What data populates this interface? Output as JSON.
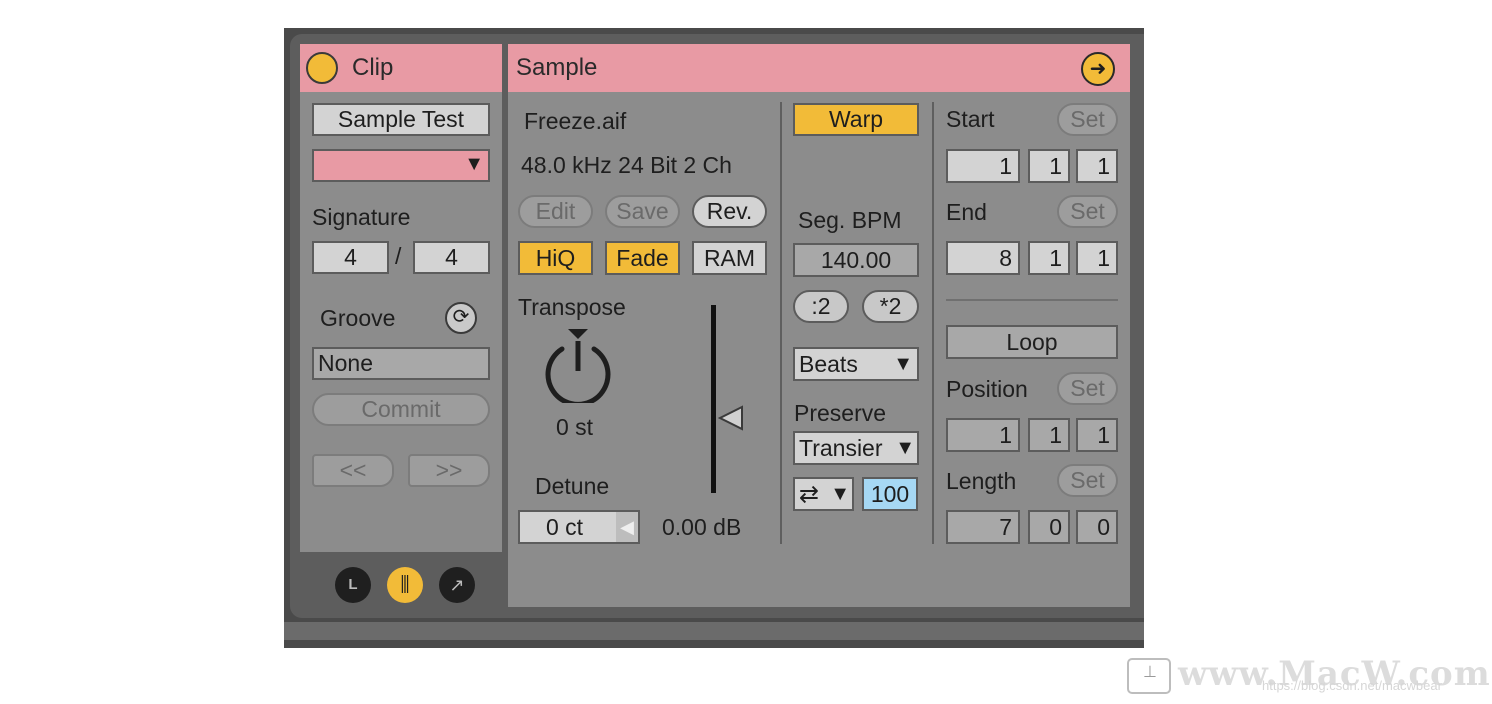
{
  "clip": {
    "title": "Clip",
    "name": "Sample Test",
    "signature_label": "Signature",
    "signature_num": "4",
    "signature_slash": "/",
    "signature_den": "4",
    "groove_label": "Groove",
    "groove_value": "None",
    "commit_label": "Commit",
    "nav_prev": "<<",
    "nav_next": ">>",
    "color": "#e89aa4"
  },
  "view_buttons": [
    {
      "icon": "launch-icon",
      "glyph": "L"
    },
    {
      "icon": "sample-waveform-icon",
      "glyph": "⫼"
    },
    {
      "icon": "envelope-icon",
      "glyph": "↗"
    }
  ],
  "sample": {
    "title": "Sample",
    "file_name": "Freeze.aif",
    "file_info": "48.0 kHz 24 Bit 2 Ch",
    "edit_label": "Edit",
    "save_label": "Save",
    "rev_label": "Rev.",
    "hiq_label": "HiQ",
    "fade_label": "Fade",
    "ram_label": "RAM",
    "transpose_label": "Transpose",
    "transpose_value": "0 st",
    "detune_label": "Detune",
    "detune_value": "0 ct",
    "gain_value": "0.00 dB",
    "warp_label": "Warp",
    "seg_bpm_label": "Seg. BPM",
    "seg_bpm_value": "140.00",
    "half_label": ":2",
    "double_label": "*2",
    "warp_mode": "Beats",
    "preserve_label": "Preserve",
    "preserve_value": "Transier",
    "loop_mode_glyph": "⇄",
    "envelope_value": "100",
    "start_label": "Start",
    "start_values": [
      "1",
      "1",
      "1"
    ],
    "end_label": "End",
    "end_values": [
      "8",
      "1",
      "1"
    ],
    "set_label": "Set",
    "loop_label": "Loop",
    "position_label": "Position",
    "position_values": [
      "1",
      "1",
      "1"
    ],
    "length_label": "Length",
    "length_values": [
      "7",
      "0",
      "0"
    ]
  },
  "watermark": {
    "text": "www.MacW.com",
    "url": "https://blog.csdn.net/macwbear"
  },
  "colors": {
    "accent": "#f2bb38",
    "header": "#e89aa4",
    "panel": "#8c8c8c",
    "field": "#d3d3d3",
    "active_value": "#a6d8f4"
  }
}
